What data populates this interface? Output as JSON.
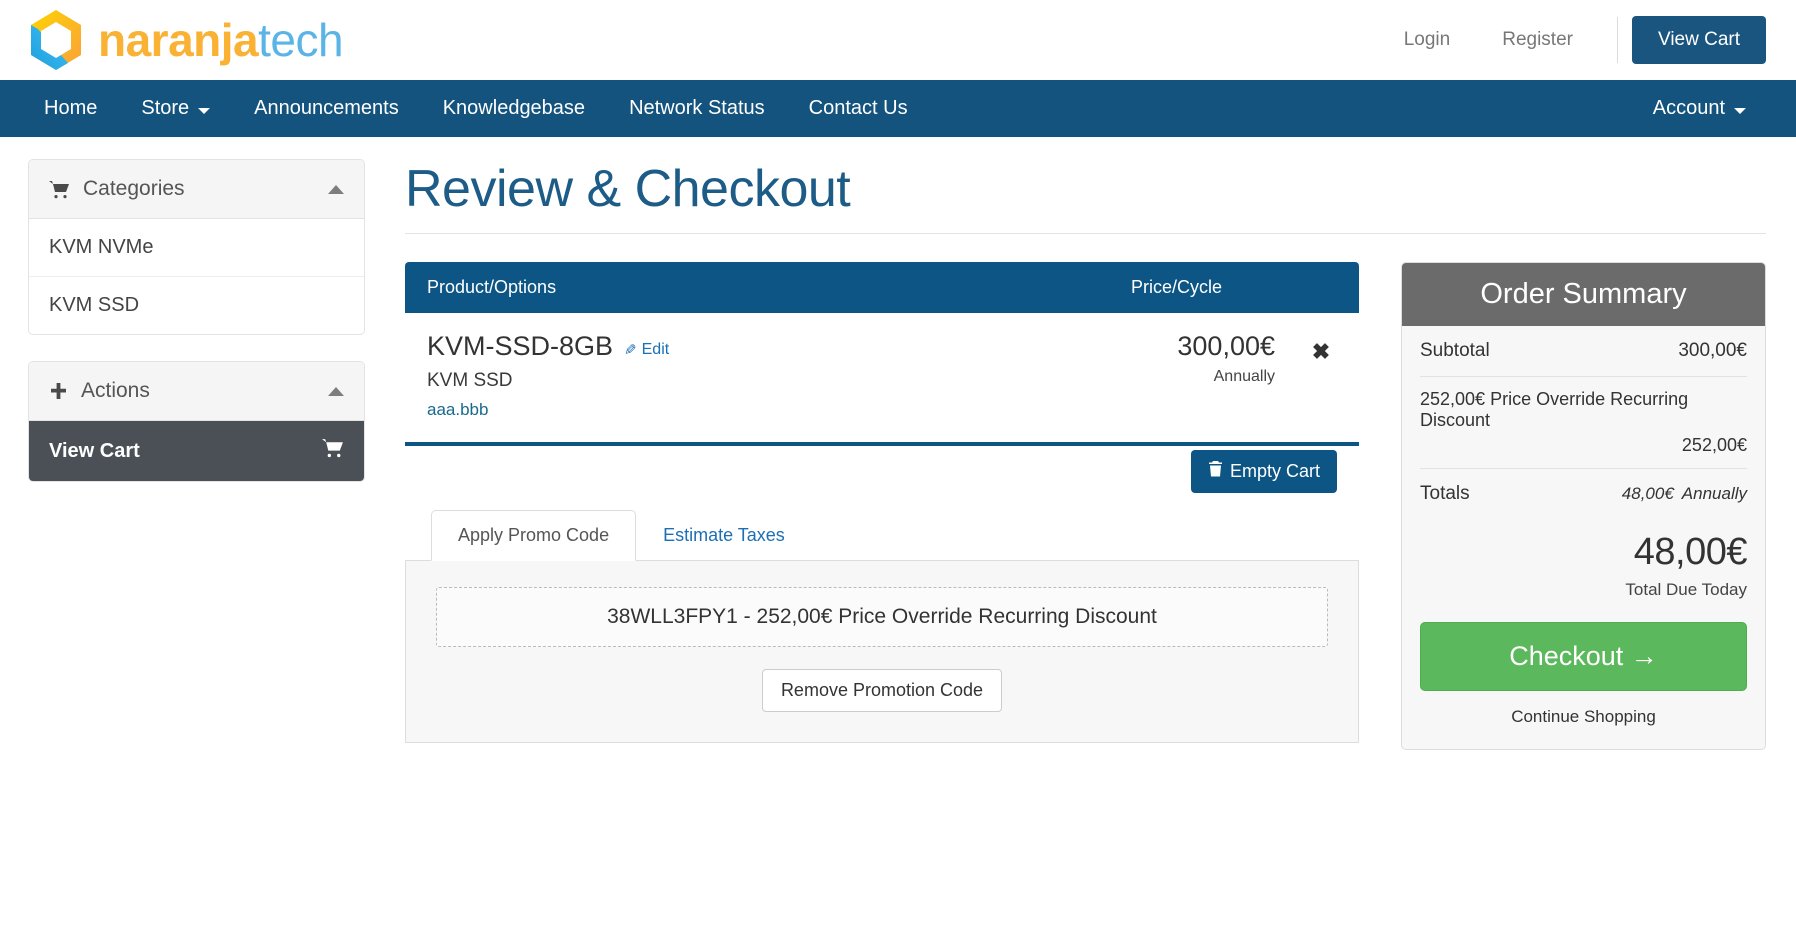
{
  "header": {
    "brand": {
      "part1": "naranja",
      "part2": "tech",
      "logo_icon": "hexagon-logo-icon"
    },
    "login_label": "Login",
    "register_label": "Register",
    "view_cart_label": "View Cart"
  },
  "nav": {
    "items": [
      {
        "label": "Home",
        "has_caret": false
      },
      {
        "label": "Store",
        "has_caret": true
      },
      {
        "label": "Announcements",
        "has_caret": false
      },
      {
        "label": "Knowledgebase",
        "has_caret": false
      },
      {
        "label": "Network Status",
        "has_caret": false
      },
      {
        "label": "Contact Us",
        "has_caret": false
      }
    ],
    "account_label": "Account"
  },
  "sidebar": {
    "categories": {
      "title": "Categories",
      "icon": "shopping-cart-icon",
      "items": [
        {
          "label": "KVM NVMe"
        },
        {
          "label": "KVM SSD"
        }
      ]
    },
    "actions": {
      "title": "Actions",
      "icon": "plus-icon",
      "items": [
        {
          "label": "View Cart",
          "icon": "shopping-cart-icon",
          "active": true
        }
      ]
    }
  },
  "main": {
    "page_title": "Review & Checkout",
    "cart": {
      "col_product": "Product/Options",
      "col_price": "Price/Cycle",
      "rows": [
        {
          "name": "KVM-SSD-8GB",
          "edit_label": "Edit",
          "subtitle": "KVM SSD",
          "domain": "aaa.bbb",
          "price": "300,00€",
          "cycle": "Annually",
          "remove_label": "✖"
        }
      ],
      "empty_cart_label": "Empty Cart"
    },
    "tabs": [
      {
        "label": "Apply Promo Code",
        "active": true
      },
      {
        "label": "Estimate Taxes",
        "active": false
      }
    ],
    "promo": {
      "applied_text": "38WLL3FPY1 - 252,00€  Price Override Recurring Discount",
      "remove_label": "Remove Promotion Code"
    }
  },
  "summary": {
    "title": "Order Summary",
    "subtotal_label": "Subtotal",
    "subtotal_value": "300,00€",
    "discount_label": "252,00€  Price Override Recurring Discount",
    "discount_value": "252,00€",
    "totals_label": "Totals",
    "totals_value": "48,00€",
    "totals_cycle": "Annually",
    "due_amount": "48,00€",
    "due_label": "Total Due Today",
    "checkout_label": "Checkout",
    "checkout_arrow": "→",
    "continue_label": "Continue Shopping"
  },
  "colors": {
    "brand_yellow": "#f9b233",
    "brand_blue": "#5bb4e5",
    "nav_blue": "#13537d",
    "table_blue": "#0d5584",
    "title_blue": "#1c5c87",
    "summary_gray": "#6b6b6b",
    "checkout_green": "#5cb85c",
    "active_item_gray": "#4a5056"
  }
}
